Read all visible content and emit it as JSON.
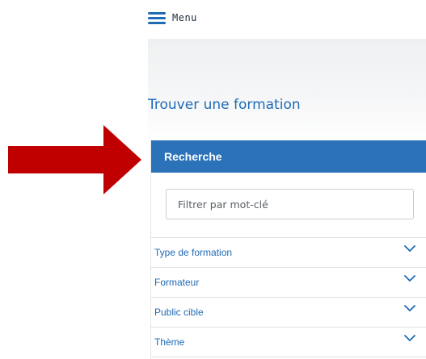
{
  "menu": {
    "label": "Menu",
    "icon": "hamburger-icon"
  },
  "page": {
    "title": "Trouver une formation"
  },
  "search_panel": {
    "header": "Recherche",
    "keyword_placeholder": "Filtrer par mot-clé",
    "filters": [
      {
        "label": "Type de formation",
        "icon": "chevron-down-icon"
      },
      {
        "label": "Formateur",
        "icon": "chevron-down-icon"
      },
      {
        "label": "Public cible",
        "icon": "chevron-down-icon"
      },
      {
        "label": "Thème",
        "icon": "chevron-down-icon"
      }
    ]
  },
  "annotation": {
    "icon": "red-arrow-icon",
    "color": "#c00000"
  },
  "colors": {
    "accent": "#1f6ab5",
    "panel_header": "#2b72b9"
  }
}
